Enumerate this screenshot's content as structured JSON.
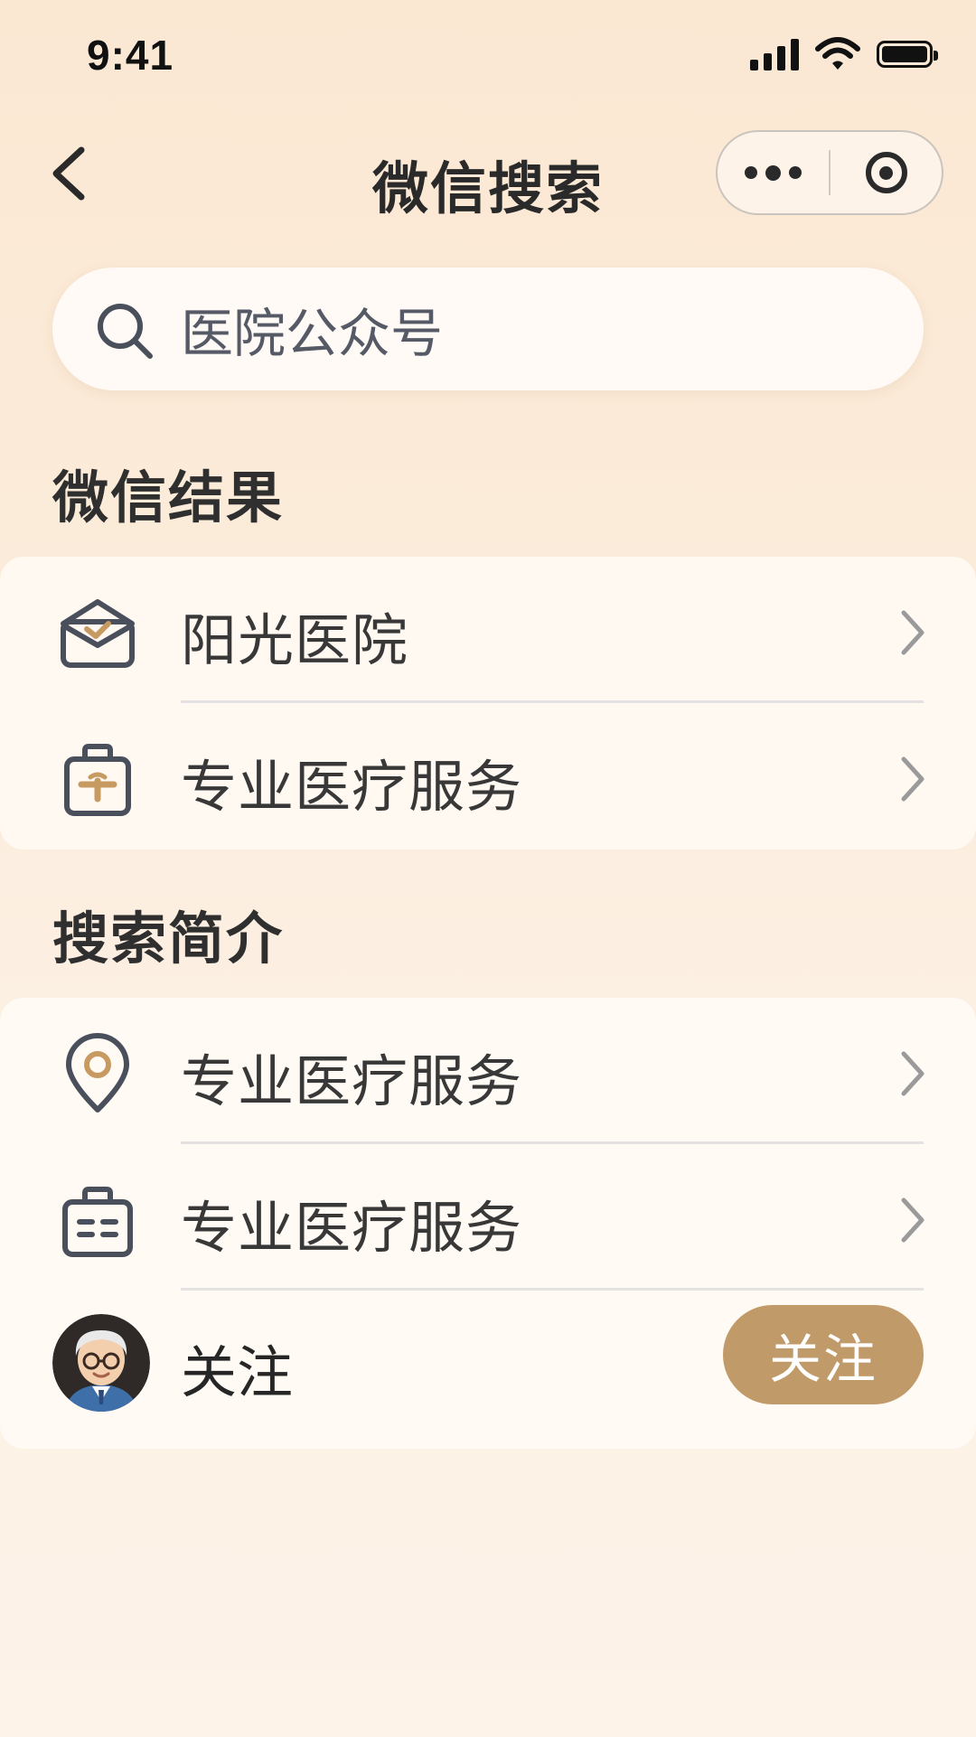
{
  "status_bar": {
    "time": "9:41"
  },
  "nav": {
    "title": "微信搜索"
  },
  "search": {
    "value": "医院公众号"
  },
  "sections": {
    "wechat_results": {
      "title": "微信结果",
      "items": [
        {
          "label": "阳光医院",
          "icon": "hospital-box-icon"
        },
        {
          "label": "专业医疗服务",
          "icon": "medical-kit-icon"
        }
      ]
    },
    "search_intro": {
      "title": "搜索简介",
      "items": [
        {
          "label": "专业医疗服务",
          "icon": "location-pin-icon"
        },
        {
          "label": "专业医疗服务",
          "icon": "briefcase-icon"
        }
      ],
      "follow": {
        "label": "关注",
        "button_label": "关注"
      }
    }
  },
  "colors": {
    "accent_button": "#c19a69",
    "location_pin_accent": "#c79a62",
    "icon_stroke": "#4a4f5c"
  }
}
